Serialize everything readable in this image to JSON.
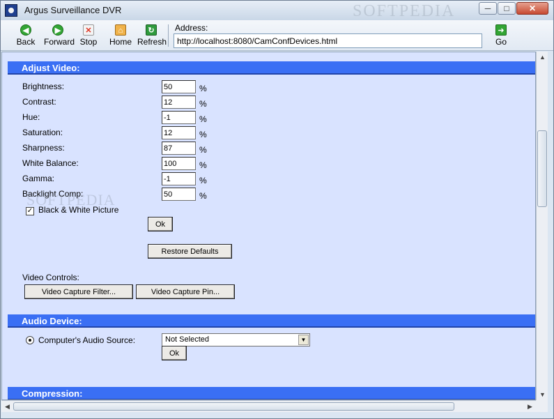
{
  "window": {
    "title": "Argus Surveillance DVR",
    "watermark": "SOFTPEDIA"
  },
  "toolbar": {
    "back_label": "Back",
    "forward_label": "Forward",
    "stop_label": "Stop",
    "home_label": "Home",
    "refresh_label": "Refresh",
    "address_label": "Address:",
    "address_value": "http://localhost:8080/CamConfDevices.html",
    "go_label": "Go"
  },
  "adjust_video": {
    "title": "Adjust Video:",
    "fields": [
      {
        "label": "Brightness:",
        "value": "50",
        "unit": "%"
      },
      {
        "label": "Contrast:",
        "value": "12",
        "unit": "%"
      },
      {
        "label": "Hue:",
        "value": "-1",
        "unit": "%"
      },
      {
        "label": "Saturation:",
        "value": "12",
        "unit": "%"
      },
      {
        "label": "Sharpness:",
        "value": "87",
        "unit": "%"
      },
      {
        "label": "White Balance:",
        "value": "100",
        "unit": "%"
      },
      {
        "label": "Gamma:",
        "value": "-1",
        "unit": "%"
      },
      {
        "label": "Backlight Comp:",
        "value": "50",
        "unit": "%"
      }
    ],
    "bw_label": "Black & White Picture",
    "bw_checked": true,
    "ok_label": "Ok",
    "restore_label": "Restore Defaults",
    "video_controls_label": "Video Controls:",
    "capture_filter_label": "Video Capture Filter...",
    "capture_pin_label": "Video Capture Pin..."
  },
  "audio_device": {
    "title": "Audio Device:",
    "source_label": "Computer's Audio Source:",
    "source_selected": "Not Selected",
    "ok_label": "Ok"
  },
  "compression": {
    "title": "Compression:"
  },
  "icons": [
    "app-icon",
    "back-icon",
    "forward-icon",
    "stop-icon",
    "home-icon",
    "refresh-icon",
    "go-icon",
    "minimize-icon",
    "maximize-icon",
    "close-icon",
    "chevron-up-icon",
    "chevron-down-icon",
    "chevron-left-icon",
    "chevron-right-icon"
  ]
}
